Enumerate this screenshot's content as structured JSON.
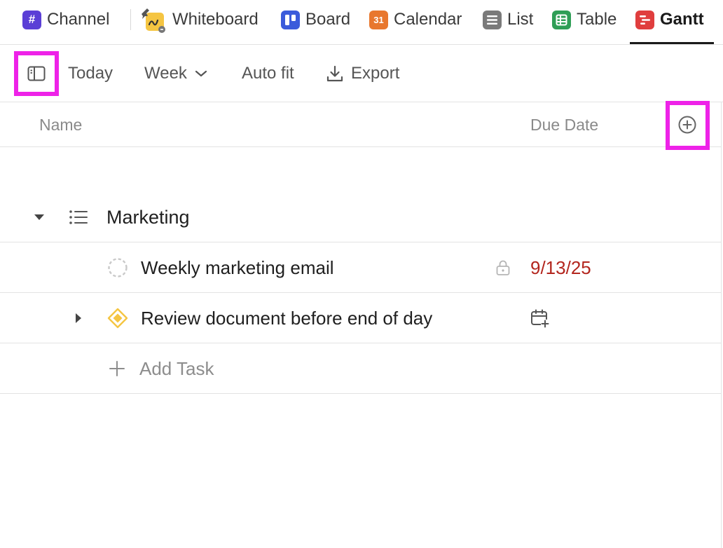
{
  "tabs": [
    {
      "label": "Channel",
      "icon": "hash-icon",
      "color": "#5b3fd6"
    },
    {
      "label": "Whiteboard",
      "icon": "whiteboard-icon",
      "color": "#f5c542"
    },
    {
      "label": "Board",
      "icon": "board-icon",
      "color": "#3b5bdb"
    },
    {
      "label": "Calendar",
      "icon": "calendar-icon",
      "color": "#e8772e",
      "icon_text": "31"
    },
    {
      "label": "List",
      "icon": "list-icon",
      "color": "#7a7a7a"
    },
    {
      "label": "Table",
      "icon": "table-icon",
      "color": "#2f9e56"
    },
    {
      "label": "Gantt",
      "icon": "gantt-icon",
      "color": "#e03e3e",
      "active": true
    }
  ],
  "toolbar": {
    "today": "Today",
    "scale": "Week",
    "auto_fit": "Auto fit",
    "export": "Export"
  },
  "columns": {
    "name": "Name",
    "due_date": "Due Date"
  },
  "group": {
    "name": "Marketing"
  },
  "tasks": [
    {
      "name": "Weekly marketing email",
      "due_date": "9/13/25",
      "due_color": "#b3261e",
      "status": "todo",
      "locked": true
    },
    {
      "name": "Review document before end of day",
      "due_date": "",
      "status": "milestone",
      "has_subtasks": true
    }
  ],
  "add_task_label": "Add Task",
  "colors": {
    "highlight": "#ee22e8",
    "border": "#e3e3e3",
    "overdue": "#b3261e",
    "milestone": "#f5c542"
  }
}
